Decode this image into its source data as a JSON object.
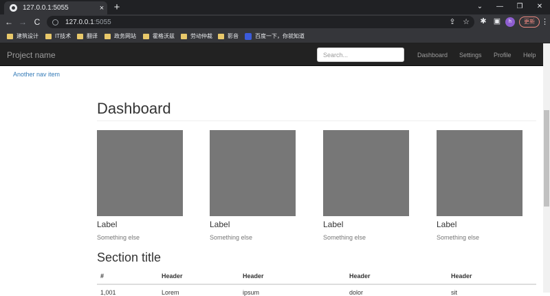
{
  "browser": {
    "tab_title": "127.0.0.1:5055",
    "tab_close": "×",
    "new_tab": "+",
    "url_host": "127.0.0.1",
    "url_port": ":5055",
    "profile_initial": "h",
    "update_label": "更新",
    "bookmarks": [
      "建筑设计",
      "IT技术",
      "翻译",
      "政务网站",
      "霍格沃兹",
      "劳动仲裁",
      "影音",
      "百度一下，你就知道"
    ],
    "icons": {
      "back": "←",
      "forward": "→",
      "reload": "C",
      "share": "⇪",
      "star": "☆",
      "extensions": "✱",
      "sidepanel": "▣",
      "menu": "⋮",
      "win_chevron": "⌄",
      "win_minimize": "—",
      "win_restore": "❐",
      "win_close": "✕"
    }
  },
  "navbar": {
    "brand": "Project name",
    "search_placeholder": "Search...",
    "links": [
      "Dashboard",
      "Settings",
      "Profile",
      "Help"
    ]
  },
  "sidebar": {
    "items": [
      "Another nav item"
    ]
  },
  "main": {
    "title": "Dashboard",
    "placeholders": [
      {
        "label": "Label",
        "sublabel": "Something else"
      },
      {
        "label": "Label",
        "sublabel": "Something else"
      },
      {
        "label": "Label",
        "sublabel": "Something else"
      },
      {
        "label": "Label",
        "sublabel": "Something else"
      }
    ],
    "section_title": "Section title",
    "table": {
      "headers": [
        "#",
        "Header",
        "Header",
        "Header",
        "Header"
      ],
      "rows": [
        [
          "1,001",
          "Lorem",
          "ipsum",
          "dolor",
          "sit"
        ]
      ]
    }
  },
  "colors": {
    "navbar_bg": "#222222",
    "link": "#337ab7",
    "placeholder_gray": "#777777"
  }
}
